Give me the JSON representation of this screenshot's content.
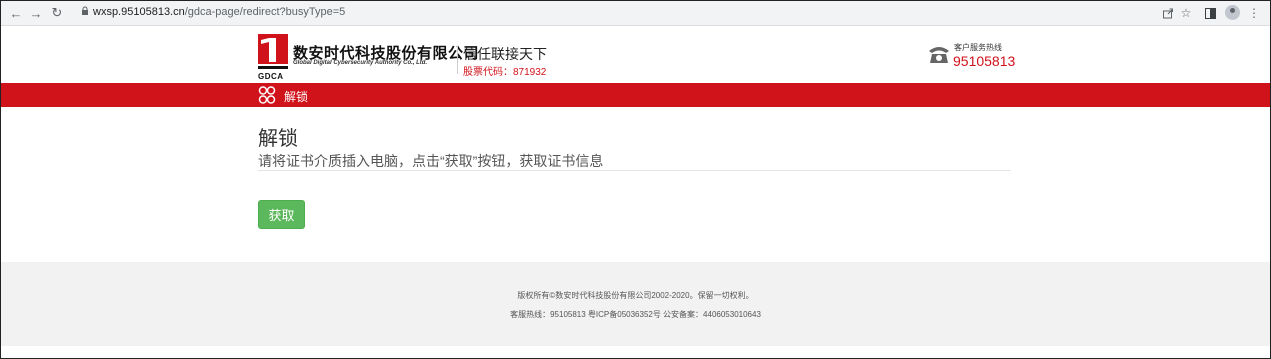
{
  "browser": {
    "url_host": "wxsp.95105813.cn",
    "url_path": "/gdca-page/redirect?busyType=5",
    "icons": [
      "back-icon",
      "forward-icon",
      "reload-icon",
      "lock-icon",
      "share-icon",
      "star-icon",
      "sidebar-icon",
      "profile-avatar",
      "menu-icon"
    ]
  },
  "header": {
    "company_name": "数安时代科技股份有限公司",
    "company_name_en": "Global Digital Cybersecurity Authority Co., Ltd.",
    "logo_abbr": "GDCA",
    "slogan": "信任联接天下",
    "stock_code": "股票代码：871932",
    "hotline_label": "客户服务热线",
    "hotline_number": "95105813"
  },
  "nav": {
    "label": "解锁"
  },
  "main": {
    "title": "解锁",
    "description": "请将证书介质插入电脑，点击“获取”按钮，获取证书信息",
    "get_button": "获取"
  },
  "footer": {
    "copyright": "版权所有©数安时代科技股份有限公司2002-2020。保留一切权利。",
    "contact": "客服热线：95105813 粤ICP备05036352号 公安备案：4406053010643"
  },
  "colors": {
    "brand_red": "#d0121a",
    "button_green": "#5cb85c",
    "footer_bg": "#f2f2f2"
  }
}
